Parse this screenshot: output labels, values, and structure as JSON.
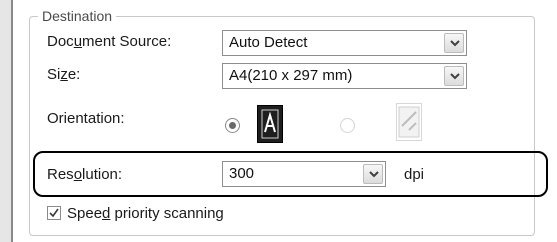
{
  "destination": {
    "group_title": "Destination",
    "document_source": {
      "label_before": "Doc",
      "label_mnemonic": "u",
      "label_after": "ment Source:",
      "value": "Auto Detect"
    },
    "size": {
      "label_before": "Si",
      "label_mnemonic": "z",
      "label_after": "e:",
      "value": "A4(210 x 297 mm)"
    },
    "orientation": {
      "label": "Orientation:",
      "selected": "portrait",
      "portrait_icon": "portrait-page-icon",
      "landscape_icon": "landscape-page-icon"
    },
    "resolution": {
      "label_before": "Res",
      "label_mnemonic": "o",
      "label_after": "lution:",
      "value": "300",
      "unit": "dpi"
    },
    "speed_priority": {
      "label_before": "Spee",
      "label_mnemonic": "d",
      "label_after": " priority scanning",
      "checked": true
    }
  }
}
